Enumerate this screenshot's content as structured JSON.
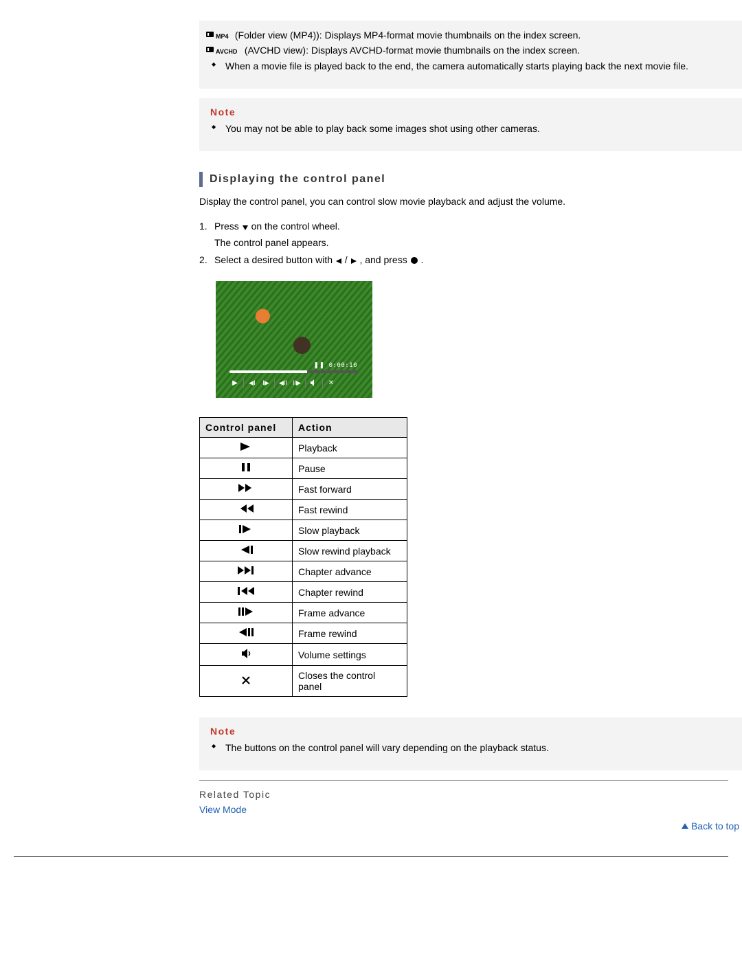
{
  "infoBox": {
    "mp4": " (Folder view (MP4)): Displays MP4-format movie thumbnails on the index screen.",
    "avchd": " (AVCHD view): Displays AVCHD-format movie thumbnails on the index screen.",
    "autoPlayNext": "When a movie file is played back to the end, the camera automatically starts playing back the next movie file."
  },
  "note1": {
    "label": "Note",
    "item": "You may not be able to play back some images shot using other cameras."
  },
  "heading": "Displaying the control panel",
  "intro": "Display the control panel, you can control slow movie playback and adjust the volume.",
  "steps": {
    "s1a": "Press ",
    "s1b": " on the control wheel.",
    "s1sub": "The control panel appears.",
    "s2a": "Select a desired button with ",
    "s2slash": " / ",
    "s2b": " , and press ",
    "s2c": " ."
  },
  "figure": {
    "timecode": "0:00:10"
  },
  "table": {
    "h1": "Control panel",
    "h2": "Action",
    "rows": [
      {
        "icon": "play",
        "action": "Playback"
      },
      {
        "icon": "pause",
        "action": "Pause"
      },
      {
        "icon": "ff",
        "action": "Fast forward"
      },
      {
        "icon": "rw",
        "action": "Fast rewind"
      },
      {
        "icon": "slow-fwd",
        "action": "Slow playback"
      },
      {
        "icon": "slow-rew",
        "action": "Slow rewind playback"
      },
      {
        "icon": "chap-next",
        "action": "Chapter advance"
      },
      {
        "icon": "chap-prev",
        "action": "Chapter rewind"
      },
      {
        "icon": "frame-fwd",
        "action": "Frame advance"
      },
      {
        "icon": "frame-rew",
        "action": "Frame rewind"
      },
      {
        "icon": "volume",
        "action": "Volume settings"
      },
      {
        "icon": "close",
        "action": "Closes the control panel"
      }
    ]
  },
  "note2": {
    "label": "Note",
    "item": "The buttons on the control panel will vary depending on the playback status."
  },
  "related": {
    "heading": "Related Topic",
    "linkLabel": "View Mode"
  },
  "backToTop": "Back to top"
}
